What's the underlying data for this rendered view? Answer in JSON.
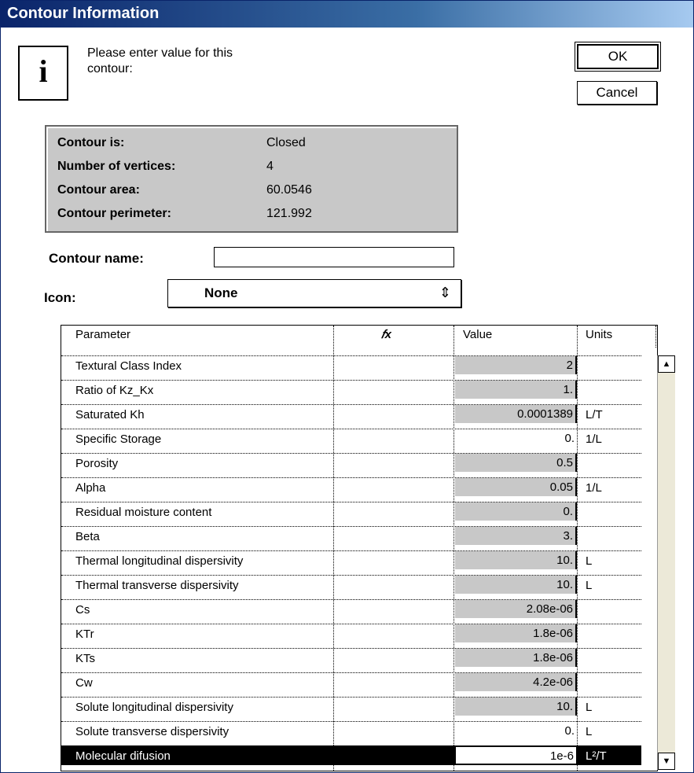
{
  "window": {
    "title": "Contour Information"
  },
  "prompt": {
    "icon": "info-icon",
    "icon_glyph": "i",
    "line1": "Please enter value for this",
    "line2": "contour:"
  },
  "buttons": {
    "ok": "OK",
    "cancel": "Cancel"
  },
  "summary": {
    "rows": [
      {
        "label": "Contour is:",
        "value": "Closed"
      },
      {
        "label": "Number of vertices:",
        "value": "4"
      },
      {
        "label": "Contour area:",
        "value": "60.0546"
      },
      {
        "label": "Contour perimeter:",
        "value": "121.992"
      }
    ]
  },
  "contour_name": {
    "label": "Contour name:",
    "value": ""
  },
  "icon_select": {
    "label": "Icon:",
    "value": "None",
    "arrow": "⇕"
  },
  "grid": {
    "headers": {
      "parameter": "Parameter",
      "fx": "𝑓x",
      "value": "Value",
      "units": "Units"
    },
    "rows": [
      {
        "parameter": "Textural Class Index",
        "value": "2",
        "units": "",
        "shaded": true
      },
      {
        "parameter": "Ratio of Kz_Kx",
        "value": "1.",
        "units": "",
        "shaded": true
      },
      {
        "parameter": "Saturated Kh",
        "value": "0.0001389",
        "units": "L/T",
        "shaded": true
      },
      {
        "parameter": "Specific Storage",
        "value": "0.",
        "units": "1/L",
        "shaded": false
      },
      {
        "parameter": "Porosity",
        "value": "0.5",
        "units": "",
        "shaded": true
      },
      {
        "parameter": "Alpha",
        "value": "0.05",
        "units": "1/L",
        "shaded": true
      },
      {
        "parameter": "Residual moisture content",
        "value": "0.",
        "units": "",
        "shaded": true
      },
      {
        "parameter": "Beta",
        "value": "3.",
        "units": "",
        "shaded": true
      },
      {
        "parameter": "Thermal longitudinal dispersivity",
        "value": "10.",
        "units": "L",
        "shaded": true
      },
      {
        "parameter": "Thermal transverse dispersivity",
        "value": "10.",
        "units": "L",
        "shaded": true
      },
      {
        "parameter": "Cs",
        "value": "2.08e-06",
        "units": "",
        "shaded": true
      },
      {
        "parameter": "KTr",
        "value": "1.8e-06",
        "units": "",
        "shaded": true
      },
      {
        "parameter": "KTs",
        "value": "1.8e-06",
        "units": "",
        "shaded": true
      },
      {
        "parameter": "Cw",
        "value": "4.2e-06",
        "units": "",
        "shaded": true
      },
      {
        "parameter": "Solute longitudinal dispersivity",
        "value": "10.",
        "units": "L",
        "shaded": true
      },
      {
        "parameter": "Solute transverse dispersivity",
        "value": "0.",
        "units": "L",
        "shaded": false
      },
      {
        "parameter": "Molecular difusion",
        "value": "1e-6",
        "units": "L²/T",
        "shaded": false,
        "selected": true
      }
    ]
  },
  "scrollbar": {
    "up": "▲",
    "down": "▼"
  }
}
